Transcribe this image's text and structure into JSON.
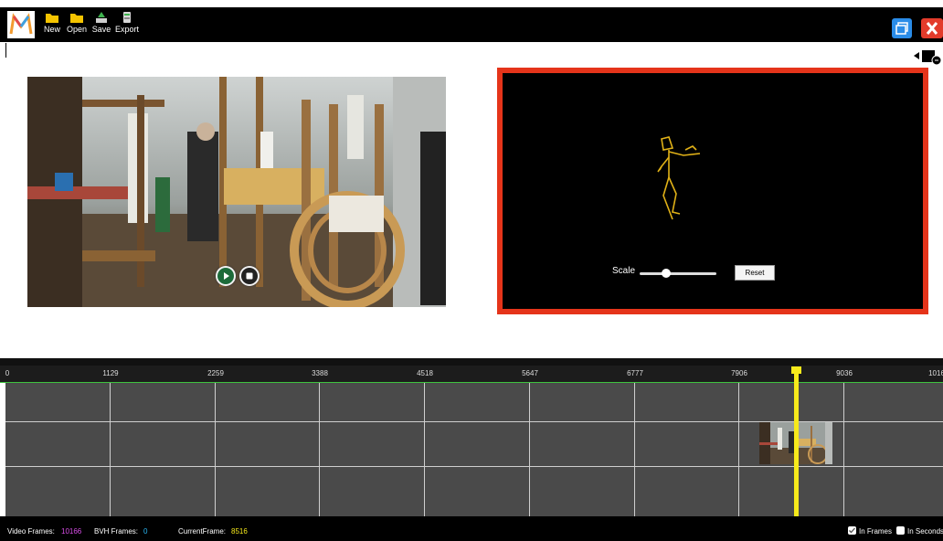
{
  "toolbar": {
    "new_label": "New",
    "open_label": "Open",
    "save_label": "Save",
    "export_label": "Export"
  },
  "bvh_panel": {
    "scale_label": "Scale",
    "reset_label": "Reset",
    "scale_value": 0.37
  },
  "timeline": {
    "ticks": [
      "0",
      "1129",
      "2259",
      "3388",
      "4518",
      "5647",
      "6777",
      "7906",
      "9036",
      "1016"
    ]
  },
  "status": {
    "video_frames_label": "Video Frames:",
    "video_frames_value": "10166",
    "bvh_frames_label": "BVH Frames:",
    "bvh_frames_value": "0",
    "current_frame_label": "CurrentFrame:",
    "current_frame_value": "8516",
    "in_frames_label": "In Frames",
    "in_seconds_label": "In Seconds",
    "in_frames_checked": true,
    "in_seconds_checked": false
  },
  "colors": {
    "accent_frame": "#e5341a",
    "playhead": "#f7ea1b",
    "video_frames_value": "#d94ee8",
    "bvh_frames_value": "#2ab8f5",
    "current_frame_value": "#f7ea1b"
  },
  "icons": [
    "app-logo-icon",
    "new-folder-icon",
    "open-folder-icon",
    "save-icon",
    "export-icon",
    "restore-window-icon",
    "close-window-icon",
    "camera-icon",
    "play-icon",
    "stop-icon"
  ]
}
